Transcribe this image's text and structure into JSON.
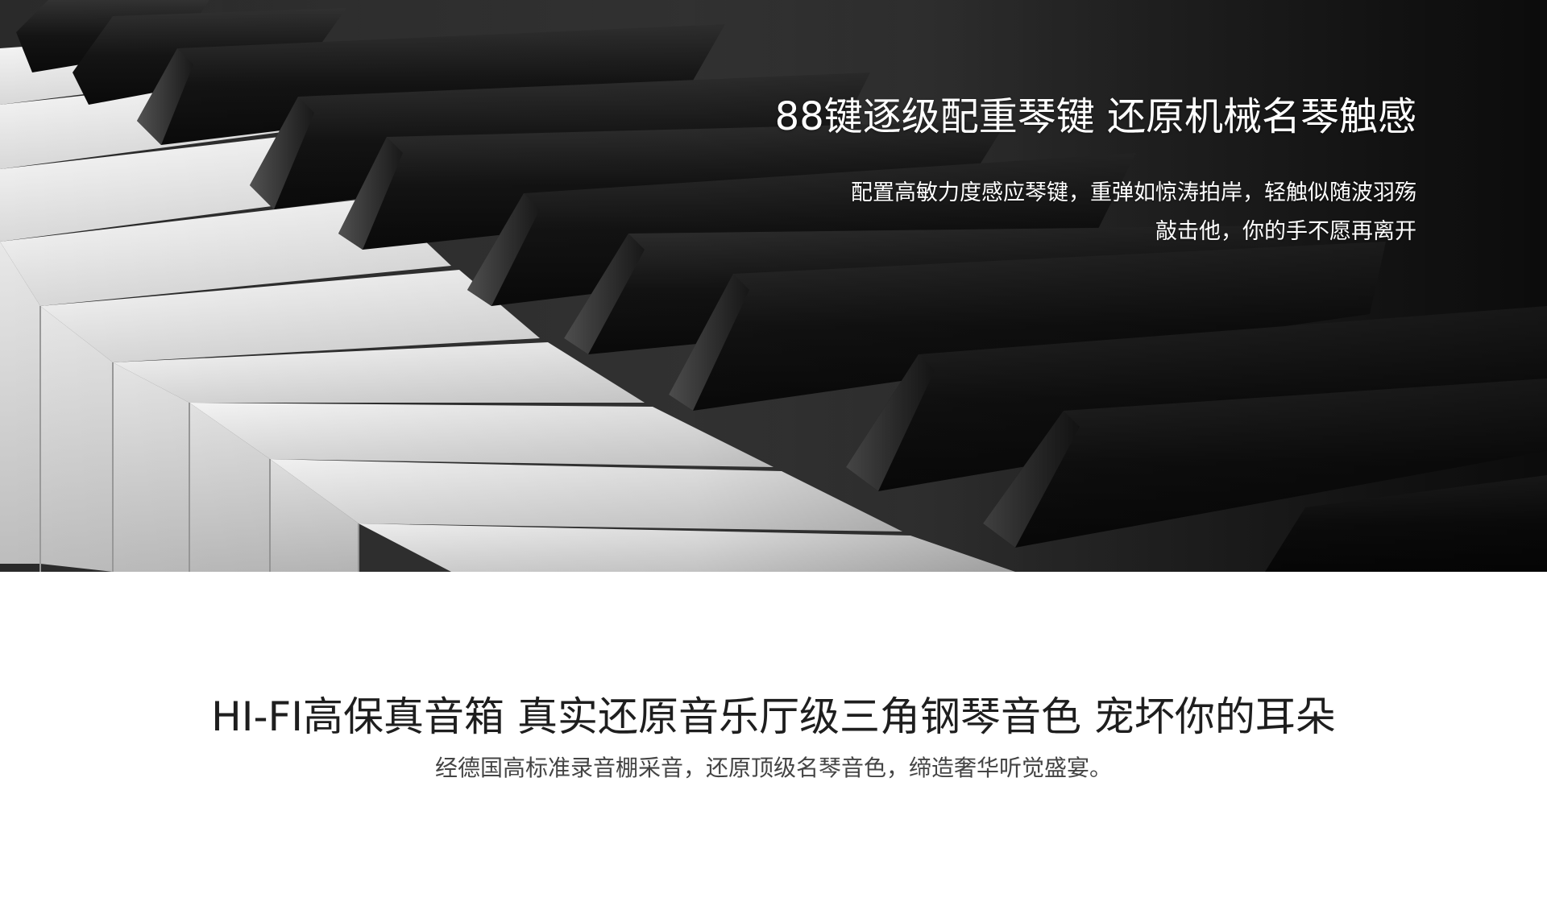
{
  "hero": {
    "title": "88键逐级配重琴键  还原机械名琴触感",
    "desc_line1": "配置高敏力度感应琴键，重弹如惊涛拍岸，轻触似随波羽殇",
    "desc_line2": "敲击他，你的手不愿再离开",
    "image": "piano-keys-photo"
  },
  "feature": {
    "title": "HI-FI高保真音箱  真实还原音乐厅级三角钢琴音色  宠坏你的耳朵",
    "desc": "经德国高标准录音棚采音，还原顶级名琴音色，缔造奢华听觉盛宴。"
  },
  "colors": {
    "background": "#ffffff",
    "hero_text": "#ffffff",
    "title_text": "#1e1e1e",
    "desc_text": "#444444"
  }
}
